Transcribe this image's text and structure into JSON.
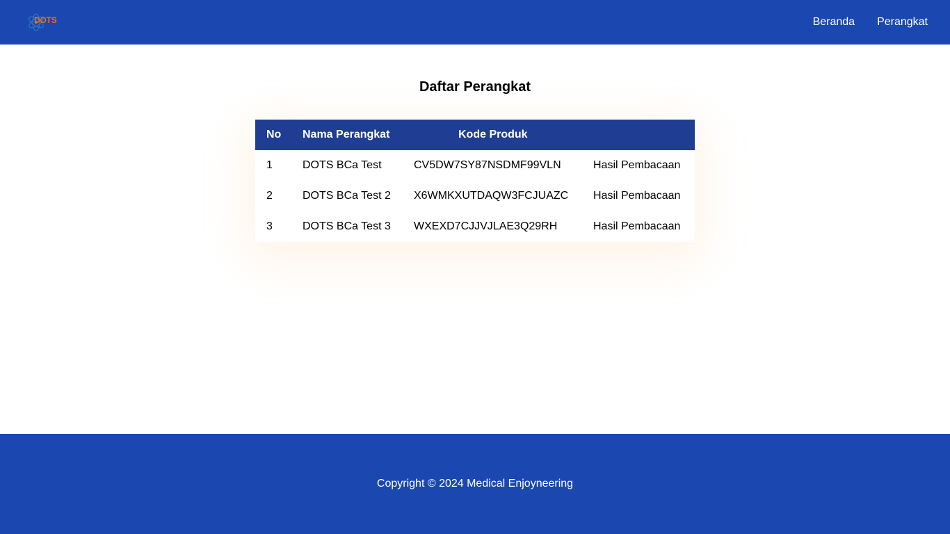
{
  "colors": {
    "primary": "#1a47b0",
    "table_header": "#1f3d93",
    "logo_accent": "#f26a21"
  },
  "navbar": {
    "logo_text": "DOTS",
    "links": [
      {
        "label": "Beranda"
      },
      {
        "label": "Perangkat"
      }
    ]
  },
  "main": {
    "title": "Daftar Perangkat",
    "table": {
      "headers": {
        "no": "No",
        "name": "Nama Perangkat",
        "kode": "Kode Produk",
        "action": ""
      },
      "rows": [
        {
          "no": "1",
          "name": "DOTS BCa Test",
          "kode": "CV5DW7SY87NSDMF99VLN",
          "action": "Hasil Pembacaan"
        },
        {
          "no": "2",
          "name": "DOTS BCa Test 2",
          "kode": "X6WMKXUTDAQW3FCJUAZC",
          "action": "Hasil Pembacaan"
        },
        {
          "no": "3",
          "name": "DOTS BCa Test 3",
          "kode": "WXEXD7CJJVJLAE3Q29RH",
          "action": "Hasil Pembacaan"
        }
      ]
    }
  },
  "footer": {
    "copyright": "Copyright © 2024 Medical Enjoyneering"
  }
}
